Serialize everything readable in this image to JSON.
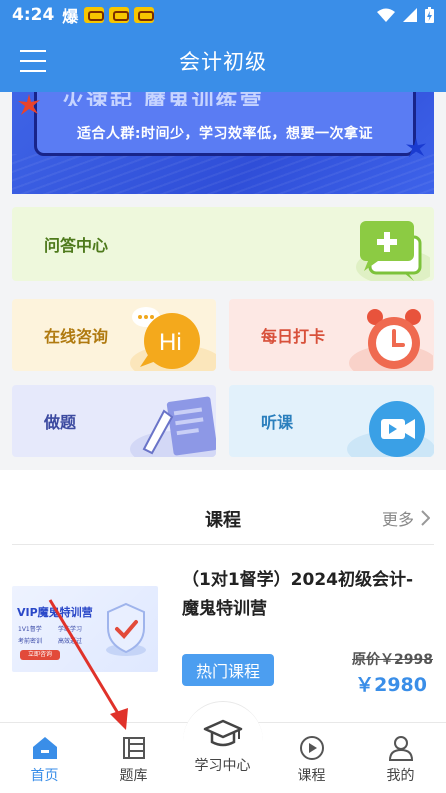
{
  "status_bar": {
    "time": "4:24",
    "app_indicator": "爆"
  },
  "header": {
    "title": "会计初级"
  },
  "banner": {
    "heading_fragment": "火速起 魔鬼训练营",
    "subtitle": "适合人群:时间少，学习效率低，想要一次拿证"
  },
  "tiles": {
    "qa": "问答中心",
    "consult": "在线咨询",
    "checkin": "每日打卡",
    "practice": "做题",
    "listen": "听课",
    "hi_text": "Hi"
  },
  "courses": {
    "section_title": "课程",
    "more_label": "更多",
    "items": [
      {
        "title": "（1对1督学）2024初级会计-魔鬼特训营",
        "badge": "热门课程",
        "original_price": "原价￥2998",
        "price": "￥2980",
        "thumb_title": "VIP魔鬼特训营",
        "thumb_lines": [
          "1V1督学",
          "学练学习",
          "考前密训",
          "高效通过"
        ],
        "thumb_button": "立即咨询"
      }
    ]
  },
  "bottom_nav": {
    "items": [
      {
        "label": "首页",
        "icon": "home-icon",
        "active": true
      },
      {
        "label": "题库",
        "icon": "question-bank-icon",
        "active": false
      },
      {
        "label": "学习中心",
        "icon": "graduation-cap-icon",
        "active": false
      },
      {
        "label": "课程",
        "icon": "play-circle-icon",
        "active": false
      },
      {
        "label": "我的",
        "icon": "user-icon",
        "active": false
      }
    ]
  },
  "colors": {
    "primary": "#3a8ee8",
    "annotation_arrow": "#e0322a"
  }
}
